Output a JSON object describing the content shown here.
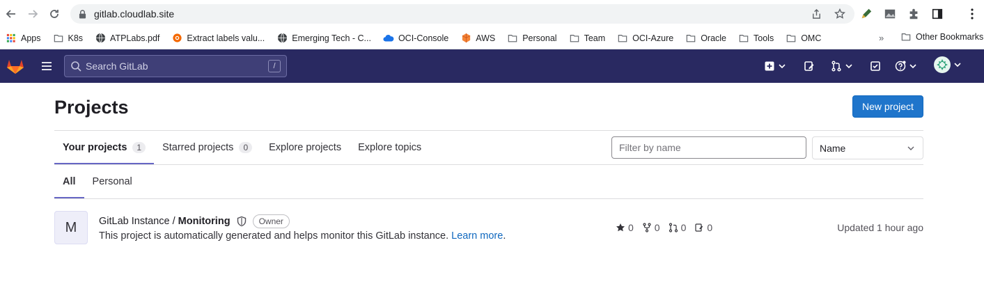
{
  "browser": {
    "url": "gitlab.cloudlab.site",
    "bookmarks": [
      {
        "label": "Apps",
        "icon": "apps-grid-icon"
      },
      {
        "label": "K8s",
        "icon": "folder-icon"
      },
      {
        "label": "ATPLabs.pdf",
        "icon": "globe-icon"
      },
      {
        "label": "Extract labels valu...",
        "icon": "grafana-icon"
      },
      {
        "label": "Emerging Tech - C...",
        "icon": "globe-icon"
      },
      {
        "label": "OCI-Console",
        "icon": "cloud-icon"
      },
      {
        "label": "AWS",
        "icon": "aws-icon"
      },
      {
        "label": "Personal",
        "icon": "folder-icon"
      },
      {
        "label": "Team",
        "icon": "folder-icon"
      },
      {
        "label": "OCI-Azure",
        "icon": "folder-icon"
      },
      {
        "label": "Oracle",
        "icon": "folder-icon"
      },
      {
        "label": "Tools",
        "icon": "folder-icon"
      },
      {
        "label": "OMC",
        "icon": "folder-icon"
      }
    ],
    "more_label": "»",
    "other_bookmarks": "Other Bookmarks"
  },
  "gitlab": {
    "search_placeholder": "Search GitLab",
    "search_shortcut": "/"
  },
  "page": {
    "title": "Projects",
    "new_project": "New project",
    "tabs": [
      {
        "label": "Your projects",
        "count": "1"
      },
      {
        "label": "Starred projects",
        "count": "0"
      },
      {
        "label": "Explore projects"
      },
      {
        "label": "Explore topics"
      }
    ],
    "filter_placeholder": "Filter by name",
    "sort_value": "Name",
    "subtabs": [
      "All",
      "Personal"
    ]
  },
  "project": {
    "avatar_letter": "M",
    "namespace": "GitLab Instance / ",
    "name": "Monitoring",
    "role": "Owner",
    "description": "This project is automatically generated and helps monitor this GitLab instance. ",
    "learn_more": "Learn more",
    "period": ".",
    "stars": "0",
    "forks": "0",
    "merge_requests": "0",
    "issues": "0",
    "updated": "Updated 1 hour ago"
  },
  "colors": {
    "header_bg": "#292961",
    "primary_button": "#1f75cb",
    "tab_underline": "#6666c4",
    "link": "#1068bf"
  }
}
